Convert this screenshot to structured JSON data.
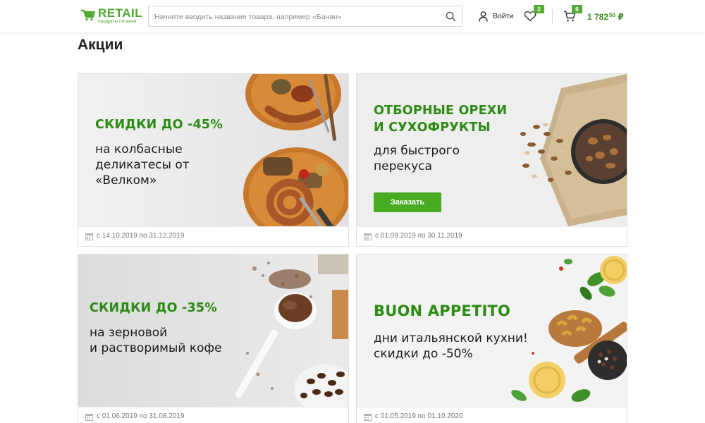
{
  "header": {
    "logo": {
      "brand": "RETAIL",
      "tagline": "продукты питания"
    },
    "search": {
      "placeholder": "Начните вводить название товара, например «Банан»",
      "value": ""
    },
    "login_label": "Войти",
    "favorites_count": "2",
    "cart_count": "6",
    "cart_total_main": "1 782",
    "cart_total_cents": "50",
    "currency": "₽"
  },
  "page": {
    "title": "Акции"
  },
  "promos": [
    {
      "headline": "СКИДКИ ДО  -45%",
      "line1": "на колбасные",
      "line2": "деликатесы от",
      "line3": "«Велком»",
      "dates": "с 14.10.2019 по 31.12.2019"
    },
    {
      "headline1": "ОТБОРНЫЕ ОРЕХИ",
      "headline2": "И СУХОФРУКТЫ",
      "line1": "для быстрого",
      "line2": "перекуса",
      "button": "Заказать",
      "dates": "с 01.09.2019 по 30.11.2019"
    },
    {
      "headline": "СКИДКИ ДО  -35%",
      "line1": "на зерновой",
      "line2": "и растворимый кофе",
      "dates": "с 01.06.2019 по 31.08.2019"
    },
    {
      "headline": "BUON APPETITO",
      "line1": "дни итальянской кухни!",
      "line2": "скидки до -50%",
      "dates": "с 01.05.2019 по 01.10.2020"
    }
  ],
  "colors": {
    "brand_green": "#4daa2e",
    "headline_green": "#2d8a14",
    "button_green": "#47ab22",
    "badge_green": "#57a935"
  },
  "icons": [
    "logo-cart-icon",
    "search-icon",
    "user-icon",
    "heart-icon",
    "cart-icon",
    "calendar-icon"
  ]
}
